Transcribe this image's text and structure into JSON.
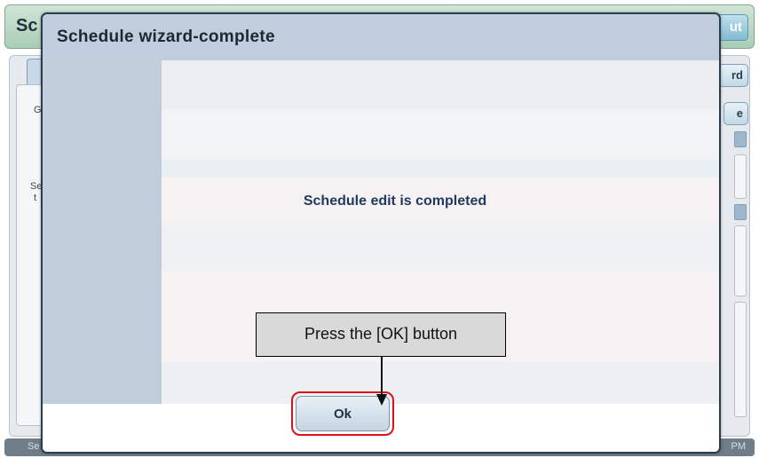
{
  "app": {
    "title_fragment": "Sc",
    "logout_fragment": "ut",
    "wizard_fragment": "rd",
    "side_button_fragment": "e",
    "left_label_g": "G",
    "left_label_s1": "Se",
    "left_label_s2": "t",
    "status_left": "Se",
    "status_right": "PM"
  },
  "dialog": {
    "title": "Schedule wizard-complete",
    "message": "Schedule edit is completed",
    "ok_label": "Ok"
  },
  "annotation": {
    "callout_text": "Press the [OK] button",
    "highlight_color": "#e0101a"
  },
  "colors": {
    "dialog_header": "#bfcddc",
    "dialog_sidebar": "#c0cedc",
    "message_text": "#1e3a5e",
    "dialog_border": "#2a3c50"
  },
  "icons": {
    "callout_arrow": "arrow-down-icon"
  }
}
